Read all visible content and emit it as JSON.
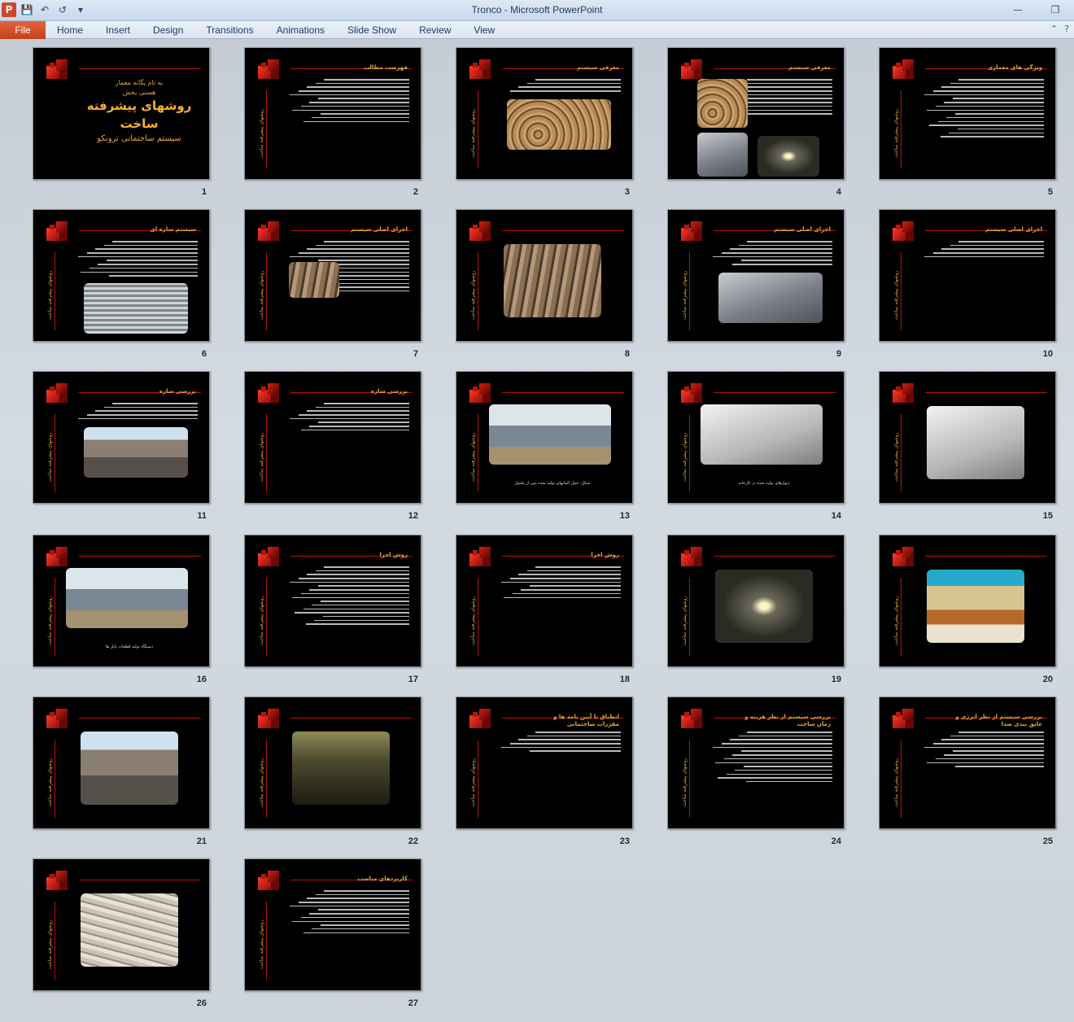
{
  "window": {
    "title": "Tronco  -  Microsoft PowerPoint",
    "app_icon": "P",
    "controls": [
      "minimize-icon",
      "restore-icon"
    ]
  },
  "ribbon": {
    "file_tab": "File",
    "tabs": [
      "Home",
      "Insert",
      "Design",
      "Transitions",
      "Animations",
      "Slide Show",
      "Review",
      "View"
    ]
  },
  "slides": [
    {
      "num": "1",
      "type": "title",
      "line1": "به نام یگانه معمار",
      "line2": "هستی بخش",
      "line3": "روشهای پیشرفته",
      "line4": "ساخت",
      "line5": "سیستم ساختمانی ترونکو"
    },
    {
      "num": "2",
      "type": "text",
      "title": "فهرست مطالب",
      "lines": 12,
      "side": "روشهای پیشرفته ساخت"
    },
    {
      "num": "3",
      "type": "textphoto",
      "title": "معرفی سیستم",
      "lines": 4,
      "photo": "wood",
      "side": "روشهای پیشرفته ساخت"
    },
    {
      "num": "4",
      "type": "multiphoto",
      "title": "معرفی سیستم",
      "side": ""
    },
    {
      "num": "5",
      "type": "text",
      "title": "ویژگی های معماری",
      "lines": 16,
      "side": "روشهای پیشرفته ساخت"
    },
    {
      "num": "6",
      "type": "textphoto",
      "title": "سیستم سازه ای",
      "lines": 10,
      "photo": "grid",
      "side": "روشهای پیشرفته ساخت"
    },
    {
      "num": "7",
      "type": "textphoto",
      "title": "اجزای اصلی سیستم",
      "lines": 14,
      "photo": "stack",
      "side": "روشهای پیشرفته ساخت"
    },
    {
      "num": "8",
      "type": "photo",
      "photo": "stack",
      "side": "روشهای پیشرفته ساخت"
    },
    {
      "num": "9",
      "type": "textphoto",
      "title": "اجزای اصلی سیستم",
      "lines": 7,
      "photo": "steel",
      "side": "روشهای پیشرفته ساخت"
    },
    {
      "num": "10",
      "type": "text",
      "title": "اجزای اصلی سیستم",
      "lines": 5,
      "side": "روشهای پیشرفته ساخت"
    },
    {
      "num": "11",
      "type": "textphoto",
      "title": "بررسی سازه",
      "lines": 5,
      "photo": "building",
      "side": "روشهای پیشرفته ساخت"
    },
    {
      "num": "12",
      "type": "text",
      "title": "بررسی سازه",
      "lines": 8,
      "side": "روشهای پیشرفته ساخت"
    },
    {
      "num": "13",
      "type": "photocap",
      "photo": "site",
      "caption": "شکل: حمل المانهای تولید شده پس از تکمیل",
      "side": "روشهای پیشرفته ساخت"
    },
    {
      "num": "14",
      "type": "photocap",
      "photo": "white3d",
      "caption": "دیوارهای تولید شده در کارخانه",
      "side": "روشهای پیشرفته ساخت"
    },
    {
      "num": "15",
      "type": "photo",
      "photo": "white3d",
      "side": "روشهای پیشرفته ساخت"
    },
    {
      "num": "16",
      "type": "photocap",
      "photo": "site",
      "caption": "دستگاه تولید قطعات پانل ها",
      "side": "روشهای پیشرفته ساخت"
    },
    {
      "num": "17",
      "type": "text",
      "title": "روش اجرا",
      "lines": 16,
      "side": "روشهای پیشرفته ساخت"
    },
    {
      "num": "18",
      "type": "text",
      "title": "روش اجرا",
      "lines": 9,
      "side": "روشهای پیشرفته ساخت"
    },
    {
      "num": "19",
      "type": "photo",
      "photo": "corridor",
      "side": "روشهای پیشرفته ساخت"
    },
    {
      "num": "20",
      "type": "photo",
      "photo": "colorful",
      "side": "روشهای پیشرفته ساخت"
    },
    {
      "num": "21",
      "type": "photo",
      "photo": "building",
      "side": "روشهای پیشرفته ساخت"
    },
    {
      "num": "22",
      "type": "photo",
      "photo": "hall",
      "side": "روشهای پیشرفته ساخت"
    },
    {
      "num": "23",
      "type": "text",
      "title": "انطباق با آیین نامه ها و مقررات ساختمانی",
      "lines": 6,
      "side": "روشهای پیشرفته ساخت"
    },
    {
      "num": "24",
      "type": "text",
      "title": "بررسی سیستم از نظر هزینه و زمان ساخت",
      "lines": 14,
      "side": "روشهای پیشرفته ساخت"
    },
    {
      "num": "25",
      "type": "text",
      "title": "بررسی سیستم از نظر انرژی و عایق بندی صدا",
      "lines": 10,
      "side": "روشهای پیشرفته ساخت"
    },
    {
      "num": "26",
      "type": "photo",
      "photo": "insul",
      "side": "روشهای پیشرفته ساخت"
    },
    {
      "num": "27",
      "type": "text",
      "title": "کاربردهای مناسب",
      "lines": 12,
      "side": "روشهای پیشرفته ساخت"
    }
  ]
}
